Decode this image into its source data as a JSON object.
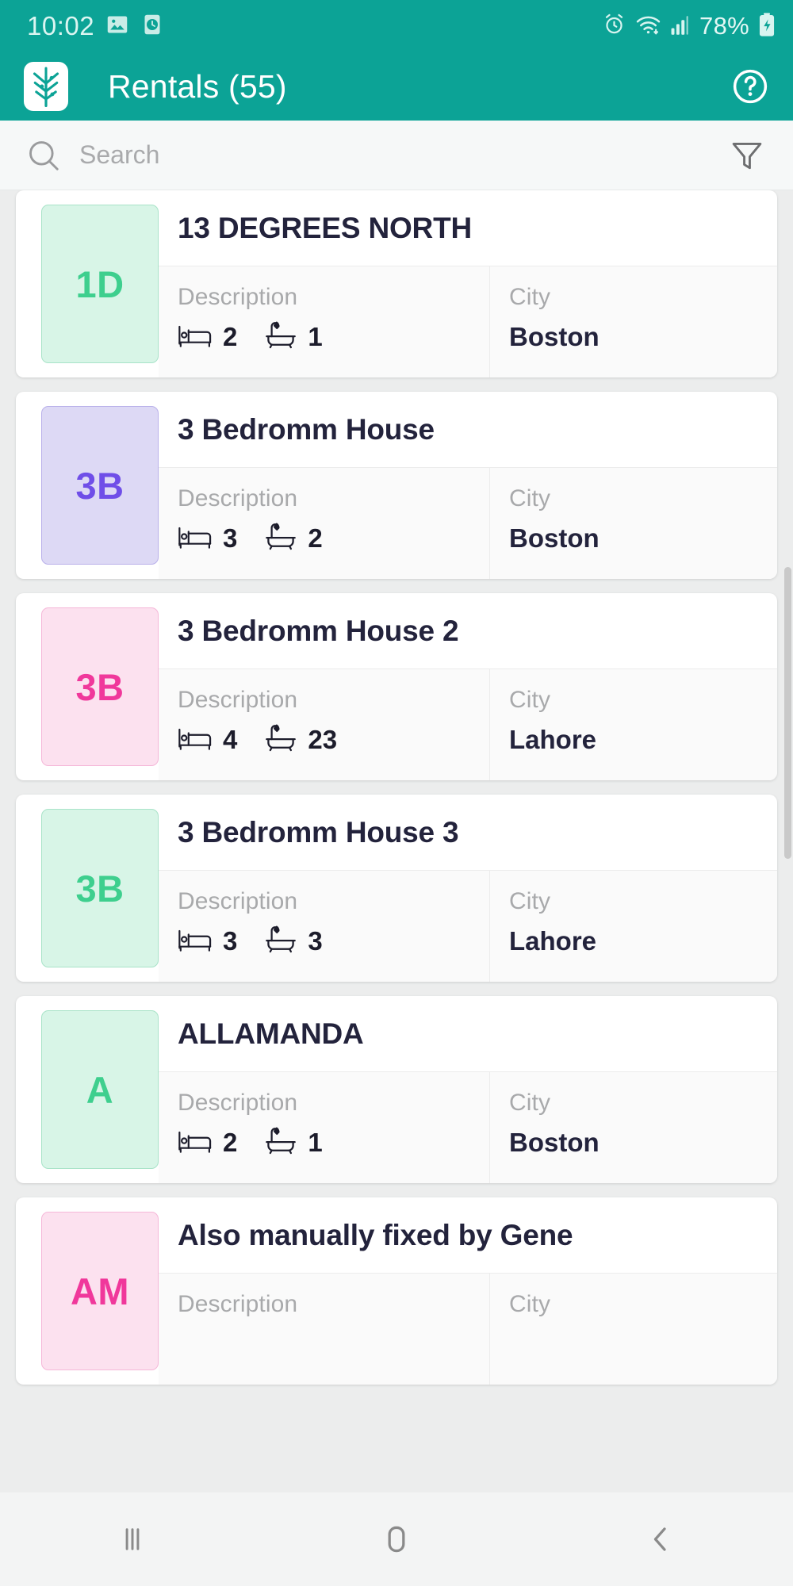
{
  "status_bar": {
    "time": "10:02",
    "battery_percent": "78%",
    "icons": [
      "image-icon",
      "clock-icon",
      "alarm-icon",
      "wifi-icon",
      "signal-icon",
      "battery-charging-icon"
    ]
  },
  "app_bar": {
    "logo": "plant-leaf-logo",
    "title": "Rentals (55)",
    "help_icon": "help-circle-icon"
  },
  "search": {
    "placeholder": "Search",
    "value": "",
    "search_icon": "search-icon",
    "filter_icon": "filter-funnel-icon"
  },
  "columns": {
    "description_label": "Description",
    "city_label": "City"
  },
  "rentals": [
    {
      "initials": "1D",
      "tile_bg": "#d8f5e7",
      "tile_border": "#a8e3c8",
      "tile_fg": "#3ecf8e",
      "title": "13 DEGREES NORTH",
      "beds": "2",
      "baths": "1",
      "city": "Boston"
    },
    {
      "initials": "3B",
      "tile_bg": "#ddd9f5",
      "tile_border": "#b9b0ea",
      "tile_fg": "#6f4ee8",
      "title": "3 Bedromm House",
      "beds": "3",
      "baths": "2",
      "city": "Boston"
    },
    {
      "initials": "3B",
      "tile_bg": "#fce1ef",
      "tile_border": "#f5b7d8",
      "tile_fg": "#f0389b",
      "title": "3 Bedromm House 2",
      "beds": "4",
      "baths": "23",
      "city": "Lahore"
    },
    {
      "initials": "3B",
      "tile_bg": "#d8f5e7",
      "tile_border": "#a8e3c8",
      "tile_fg": "#3ecf8e",
      "title": "3 Bedromm House 3",
      "beds": "3",
      "baths": "3",
      "city": "Lahore"
    },
    {
      "initials": "A",
      "tile_bg": "#d8f5e7",
      "tile_border": "#a8e3c8",
      "tile_fg": "#3ecf8e",
      "title": "ALLAMANDA",
      "beds": "2",
      "baths": "1",
      "city": "Boston"
    },
    {
      "initials": "AM",
      "tile_bg": "#fce1ef",
      "tile_border": "#f5b7d8",
      "tile_fg": "#f0389b",
      "title": "Also manually fixed by Gene",
      "beds": "",
      "baths": "",
      "city": ""
    }
  ],
  "nav_bar": {
    "recents_icon": "recents-icon",
    "home_icon": "home-icon",
    "back_icon": "back-icon"
  },
  "theme": {
    "primary": "#0CA396",
    "page_bg": "#eceded",
    "card_bg": "#ffffff",
    "title_color": "#23233c",
    "label_color": "#a8a9ab"
  }
}
